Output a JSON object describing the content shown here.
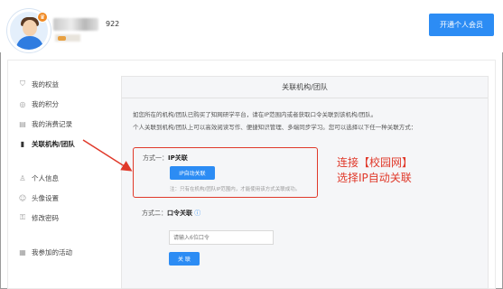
{
  "header": {
    "badge_icon": "crown-icon",
    "count": "922",
    "vip_button_label": "开通个人会员"
  },
  "sidebar": {
    "items": [
      {
        "label": "我的权益",
        "icon": "shield-icon"
      },
      {
        "label": "我的积分",
        "icon": "points-icon"
      },
      {
        "label": "我的消费记录",
        "icon": "receipt-icon"
      },
      {
        "label": "关联机构/团队",
        "icon": "document-icon",
        "active": true
      },
      {
        "label": "个人信息",
        "icon": "user-icon"
      },
      {
        "label": "头像设置",
        "icon": "avatar-icon"
      },
      {
        "label": "修改密码",
        "icon": "lock-icon"
      },
      {
        "label": "我参加的活动",
        "icon": "calendar-icon"
      }
    ]
  },
  "panel": {
    "title": "关联机构/团队",
    "desc_line1": "如您所在的机构/团队已购买了知网研学平台，请在IP范围内或者获取口令关联到该机构/团队。",
    "desc_line2": "个人关联到机构/团队上可以高效阅读写作、便捷知识管理、多端同步学习。您可以选择以下任一种关联方式：",
    "option1": {
      "prefix": "方式一：",
      "title": "IP关联",
      "button": "IP自动关联",
      "note": "注：只有在机构/团队IP范围内，才能使用该方式关联成功。"
    },
    "option2": {
      "prefix": "方式二：",
      "title": "口令关联",
      "help_icon": "question-icon",
      "input_placeholder": "请输入6位口令",
      "button": "关 联"
    }
  },
  "annotation": {
    "line1": "连接【校园网】",
    "line2": "选择IP自动关联",
    "color": "#e0392a"
  },
  "colors": {
    "accent": "#2c8cf4",
    "annotation_red": "#e0392a"
  }
}
